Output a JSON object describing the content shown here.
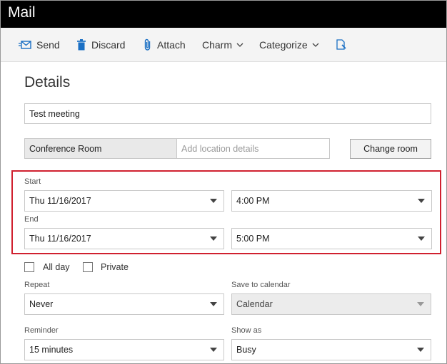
{
  "window": {
    "title": "Mail"
  },
  "toolbar": {
    "send": "Send",
    "discard": "Discard",
    "attach": "Attach",
    "charm": "Charm",
    "categorize": "Categorize"
  },
  "details": {
    "heading": "Details",
    "subject_value": "Test meeting",
    "room_value": "Conference Room",
    "location_placeholder": "Add location details",
    "change_room_label": "Change room"
  },
  "schedule": {
    "start_label": "Start",
    "start_date": "Thu 11/16/2017",
    "start_time": "4:00 PM",
    "end_label": "End",
    "end_date": "Thu 11/16/2017",
    "end_time": "5:00 PM"
  },
  "options": {
    "all_day_label": "All day",
    "private_label": "Private",
    "repeat_label": "Repeat",
    "repeat_value": "Never",
    "save_to_calendar_label": "Save to calendar",
    "save_to_calendar_value": "Calendar",
    "reminder_label": "Reminder",
    "reminder_value": "15 minutes",
    "show_as_label": "Show as",
    "show_as_value": "Busy"
  },
  "colors": {
    "titlebar": "#000000",
    "accent": "#1a6fc4",
    "highlight": "#d0202f"
  },
  "icons": {
    "send": "send-icon",
    "discard": "trash-icon",
    "attach": "paperclip-icon",
    "overflow": "document-edit-icon"
  }
}
